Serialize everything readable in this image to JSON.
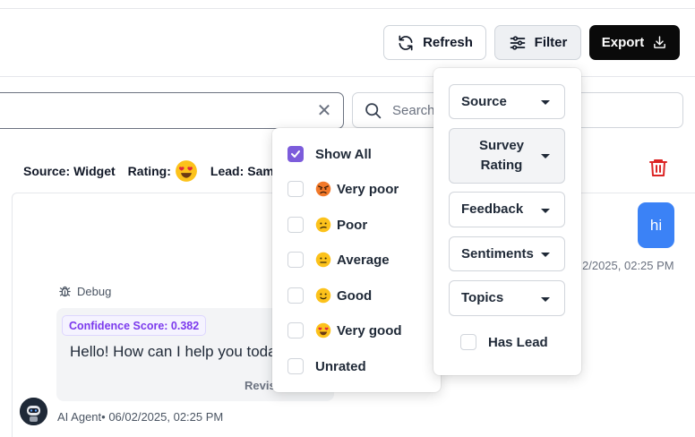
{
  "toolbar": {
    "refresh_label": "Refresh",
    "filter_label": "Filter",
    "export_label": "Export"
  },
  "search": {
    "left_value": "",
    "right_placeholder": "Search"
  },
  "meta": {
    "source_label": "Source:",
    "source_value": "Widget",
    "rating_label": "Rating:",
    "lead_label": "Lead:",
    "lead_value": "Sam"
  },
  "chat": {
    "user_message": "hi",
    "user_timestamp": "2/2025, 02:25 PM",
    "debug_label": "Debug",
    "confidence": "Confidence Score: 0.382",
    "agent_message": "Hello! How can I help you today?",
    "revise_label": "Revis",
    "agent_meta": "AI Agent• 06/02/2025, 02:25 PM"
  },
  "rating_dropdown": {
    "items": [
      {
        "label": "Show All",
        "emoji": "",
        "checked": true
      },
      {
        "label": "Very poor",
        "emoji": "angry-face-icon",
        "checked": false
      },
      {
        "label": "Poor",
        "emoji": "confused-face-icon",
        "checked": false
      },
      {
        "label": "Average",
        "emoji": "neutral-face-icon",
        "checked": false
      },
      {
        "label": "Good",
        "emoji": "slightly-smiling-face-icon",
        "checked": false
      },
      {
        "label": "Very good",
        "emoji": "heart-eyes-face-icon",
        "checked": false
      },
      {
        "label": "Unrated",
        "emoji": "",
        "checked": false
      }
    ]
  },
  "filter_dropdown": {
    "source": "Source",
    "survey_rating_line1": "Survey",
    "survey_rating_line2": "Rating",
    "feedback": "Feedback",
    "sentiments": "Sentiments",
    "topics": "Topics",
    "has_lead": "Has Lead"
  },
  "colors": {
    "accent_purple": "#7c5cdb",
    "user_bubble": "#3b82f6",
    "delete_red": "#dc2626",
    "export_bg": "#0a0a0a"
  }
}
